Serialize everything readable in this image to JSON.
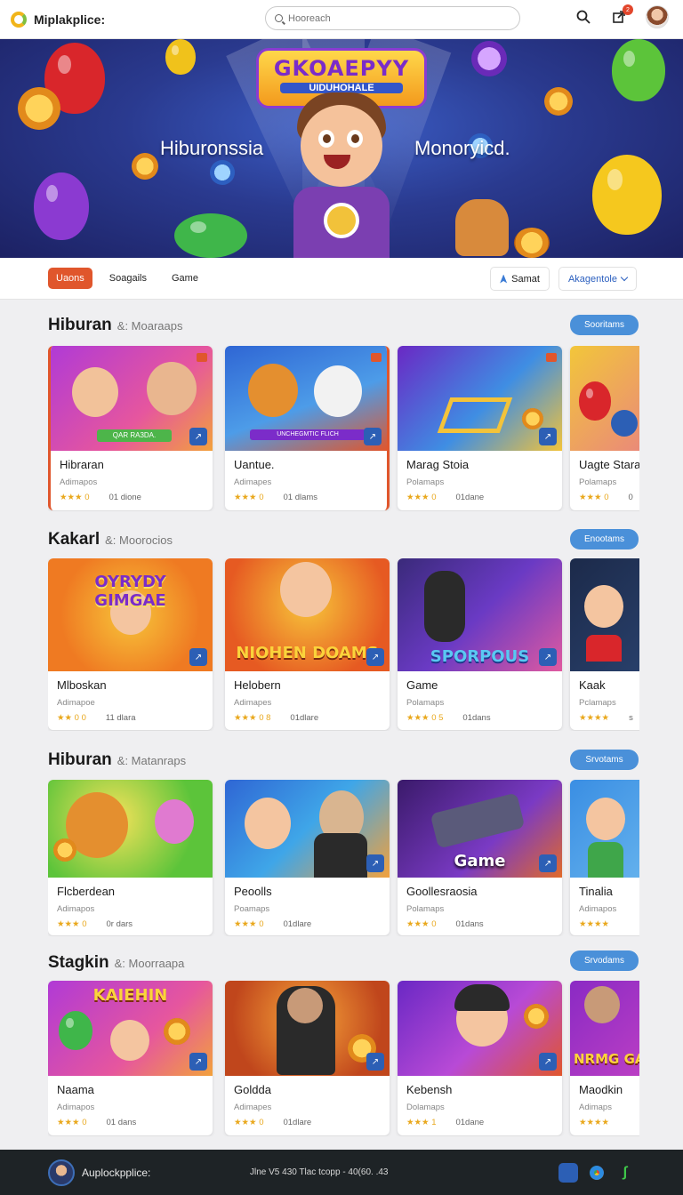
{
  "header": {
    "brand": "Miplakplice:",
    "search_placeholder": "Hooreach",
    "notif_count": "2",
    "icons": [
      "search-icon",
      "share-icon",
      "avatar"
    ]
  },
  "hero": {
    "logo_line1": "GKOAEPYY",
    "logo_line2": "UIDUHOHALE",
    "left_text": "Hiburonssia",
    "right_text": "Monoryicd."
  },
  "filters": {
    "tabs": [
      "Uaons",
      "Soagails",
      "Game"
    ],
    "active_tab": 0,
    "chip_label": "Samat",
    "dropdown_label": "Akagentole"
  },
  "sections": [
    {
      "title": "Hiburan",
      "subtitle": "&: Moaraaps",
      "button": "Sooritams",
      "cards": [
        {
          "title": "Hibraran",
          "meta": "Adimapos",
          "rating": "★★★ 0",
          "count": "01 dione",
          "overlay": "QAR RA3DA."
        },
        {
          "title": "Uantue.",
          "meta": "Adimapes",
          "rating": "★★★ 0",
          "count": "01 dlams",
          "overlay": "UNCHEGMTIC FLICH"
        },
        {
          "title": "Marag Stoia",
          "meta": "Polamaps",
          "rating": "★★★ 0",
          "count": "01dane",
          "overlay": ""
        },
        {
          "title": "Uagte Stara",
          "meta": "Polamaps",
          "rating": "★★★ 0",
          "count": "0",
          "overlay": ""
        }
      ]
    },
    {
      "title": "Kakarl",
      "subtitle": "&: Moorocios",
      "button": "Enootams",
      "cards": [
        {
          "title": "Mlboskan",
          "meta": "Adimapoe",
          "rating": "★★ 0 0",
          "count": "11 dlara",
          "overlay": "OYRYDY GIMGAE"
        },
        {
          "title": "Helobern",
          "meta": "Adimapes",
          "rating": "★★★ 0 8",
          "count": "01dlare",
          "overlay": "NIOHEN DOAMS"
        },
        {
          "title": "Game",
          "meta": "Polamaps",
          "rating": "★★★ 0 5",
          "count": "01dans",
          "overlay": "SPORPOUS"
        },
        {
          "title": "Kaak",
          "meta": "Pclamaps",
          "rating": "★★★★",
          "count": "s",
          "overlay": ""
        }
      ]
    },
    {
      "title": "Hiburan",
      "subtitle": "&: Matanraps",
      "button": "Srvotams",
      "cards": [
        {
          "title": "Flcberdean",
          "meta": "Adimapos",
          "rating": "★★★ 0",
          "count": "0r dars",
          "overlay": ""
        },
        {
          "title": "Peoolls",
          "meta": "Poamaps",
          "rating": "★★★ 0",
          "count": "01dlare",
          "overlay": ""
        },
        {
          "title": "Goollesraosia",
          "meta": "Polamaps",
          "rating": "★★★ 0",
          "count": "01dans",
          "overlay": "Game"
        },
        {
          "title": "Tinalia",
          "meta": "Adimapos",
          "rating": "★★★★",
          "count": "",
          "overlay": ""
        }
      ]
    },
    {
      "title": "Stagkin",
      "subtitle": "&: Moorraapa",
      "button": "Srvodams",
      "cards": [
        {
          "title": "Naama",
          "meta": "Adimapos",
          "rating": "★★★ 0",
          "count": "01 dans",
          "overlay": "KAIEHIN"
        },
        {
          "title": "Goldda",
          "meta": "Adimapes",
          "rating": "★★★ 0",
          "count": "01dlare",
          "overlay": ""
        },
        {
          "title": "Kebensh",
          "meta": "Dolamaps",
          "rating": "★★★ 1",
          "count": "01dane",
          "overlay": ""
        },
        {
          "title": "Maodkin",
          "meta": "Adimaps",
          "rating": "★★★★",
          "count": "",
          "overlay": "NRMG GAME"
        }
      ]
    }
  ],
  "footer": {
    "name": "Auplockpplice:",
    "info": "Jlne  V5  430   Tlac tcopp - 40(60.  .43"
  },
  "colors": {
    "accent": "#e0562c",
    "link_blue": "#4a90d9",
    "footer_bg": "#1e2326",
    "star": "#e9a81d"
  }
}
